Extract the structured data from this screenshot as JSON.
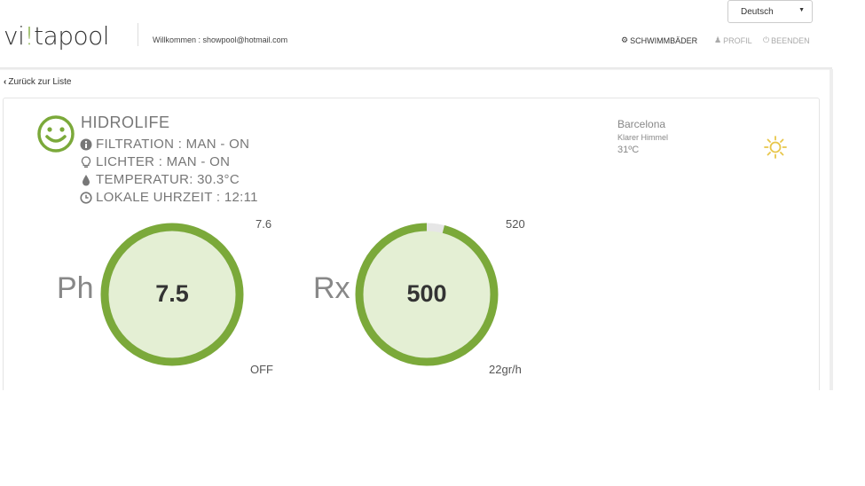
{
  "header": {
    "logo": {
      "pre": "vi",
      "dot": "!",
      "post": "tapool"
    },
    "welcome": "Willkommen : showpool@hotmail.com",
    "language": "Deutsch",
    "nav": {
      "pools": "SCHWIMMBÄDER",
      "profile": "PROFIL",
      "exit": "BEENDEN"
    }
  },
  "back_link": "Zurück zur Liste",
  "pool": {
    "name": "HIDROLIFE",
    "filtration": "FILTRATION : MAN - ON",
    "lights": "LICHTER : MAN - ON",
    "temperature": "TEMPERATUR: 30.3°C",
    "local_time": "LOKALE UHRZEIT : 12:11"
  },
  "weather": {
    "city": "Barcelona",
    "condition": "Klarer Himmel",
    "temp": "31ºC"
  },
  "gauges": {
    "ph": {
      "label": "Ph",
      "value": "7.5",
      "setpoint": "7.6",
      "status": "OFF",
      "fill": 1.0
    },
    "rx": {
      "label": "Rx",
      "value": "500",
      "setpoint": "520",
      "status": "22gr/h",
      "fill": 0.96
    }
  },
  "colors": {
    "accent": "#7ba93a",
    "gauge_inner": "#e4efd4",
    "gauge_track": "#e6e6e6",
    "sun": "#e8c64a"
  }
}
